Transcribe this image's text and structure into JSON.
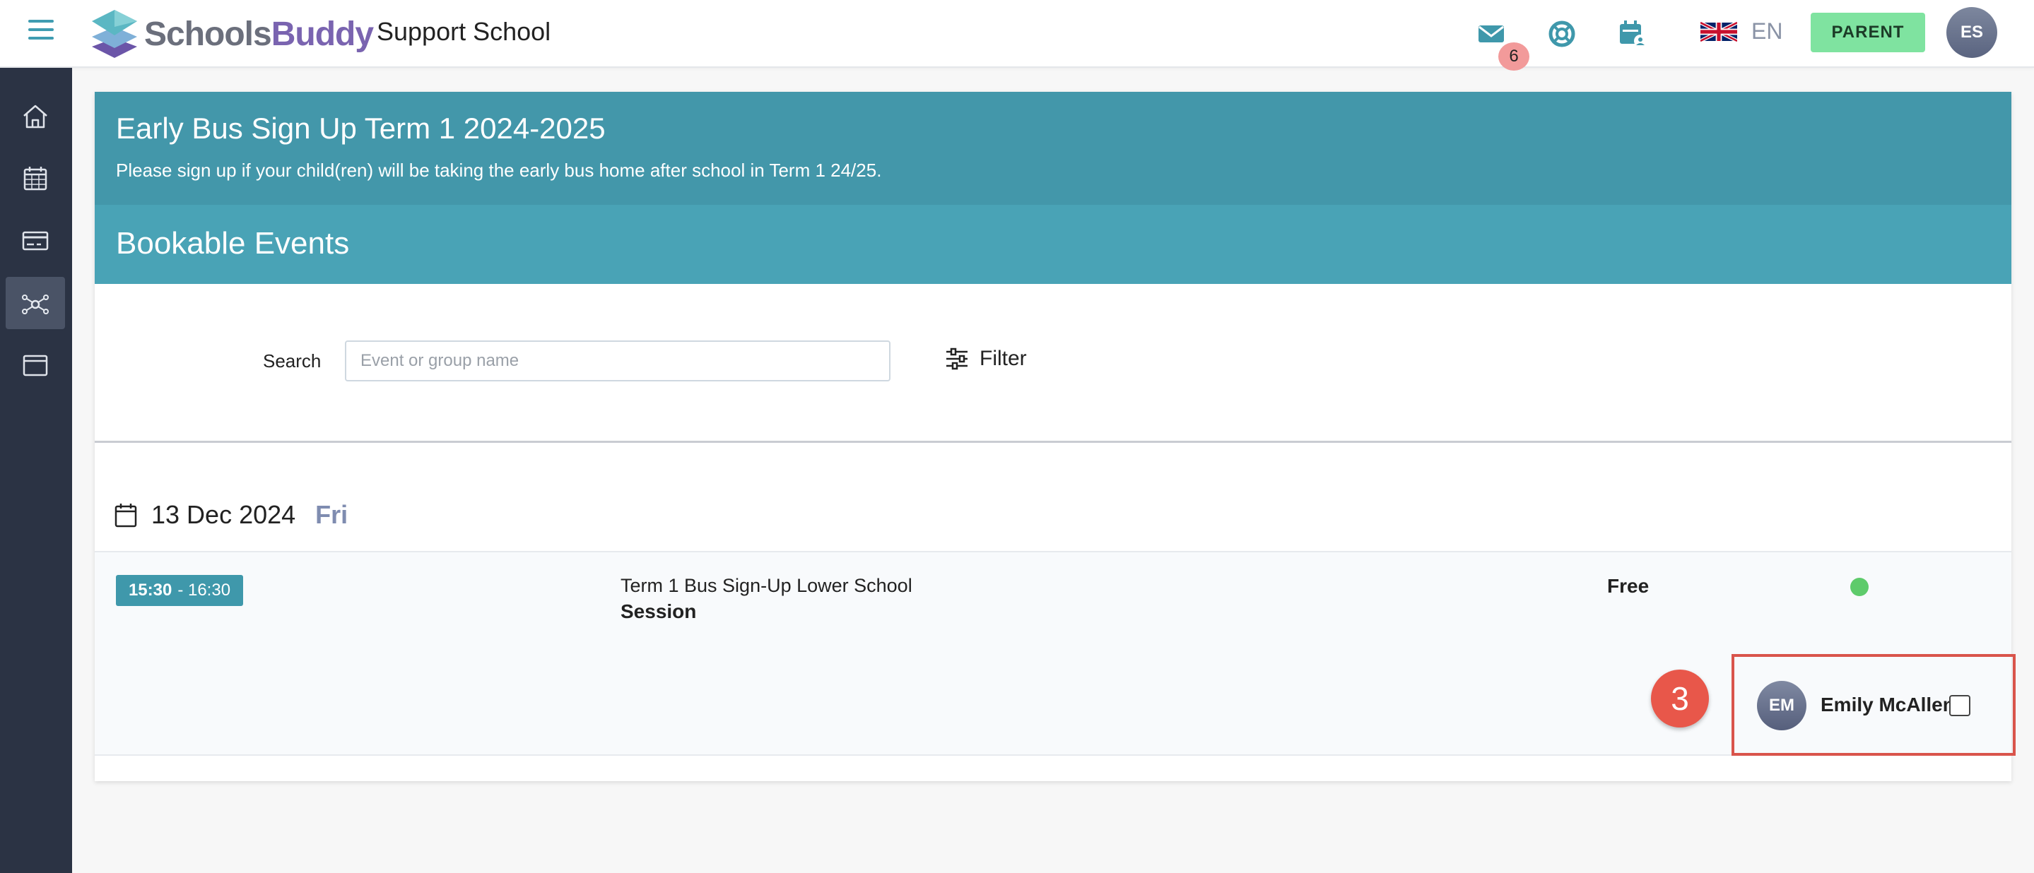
{
  "header": {
    "logo_part1": "Schools",
    "logo_part2": "Buddy",
    "school_name": "Support School",
    "messages_badge": "6",
    "language": "EN",
    "role_button": "PARENT",
    "user_initials": "ES"
  },
  "sidebar": {
    "items": [
      {
        "icon": "home-icon"
      },
      {
        "icon": "calendar-icon"
      },
      {
        "icon": "payment-card-icon"
      },
      {
        "icon": "network-icon",
        "active": true
      },
      {
        "icon": "window-icon"
      }
    ]
  },
  "banner": {
    "title": "Early Bus Sign Up Term 1 2024-2025",
    "description": "Please sign up if your child(ren) will be taking the early bus home after school in Term 1 24/25."
  },
  "section": {
    "title": "Bookable Events"
  },
  "search": {
    "label": "Search",
    "placeholder": "Event or group name",
    "filter_label": "Filter"
  },
  "events_day": {
    "date": "13 Dec 2024",
    "weekday": "Fri",
    "event": {
      "start_time": "15:30",
      "end_time": "- 16:30",
      "name": "Term 1 Bus Sign-Up Lower School",
      "type": "Session",
      "price": "Free",
      "status_color": "#5ecb6b",
      "child": {
        "initials": "EM",
        "name": "Emily McAllen",
        "checked": false
      },
      "step_marker": "3"
    }
  },
  "colors": {
    "brand_teal": "#4397aa",
    "sidebar_bg": "#2b3344",
    "parent_button": "#7fe3a0",
    "highlight": "#d9544b"
  }
}
